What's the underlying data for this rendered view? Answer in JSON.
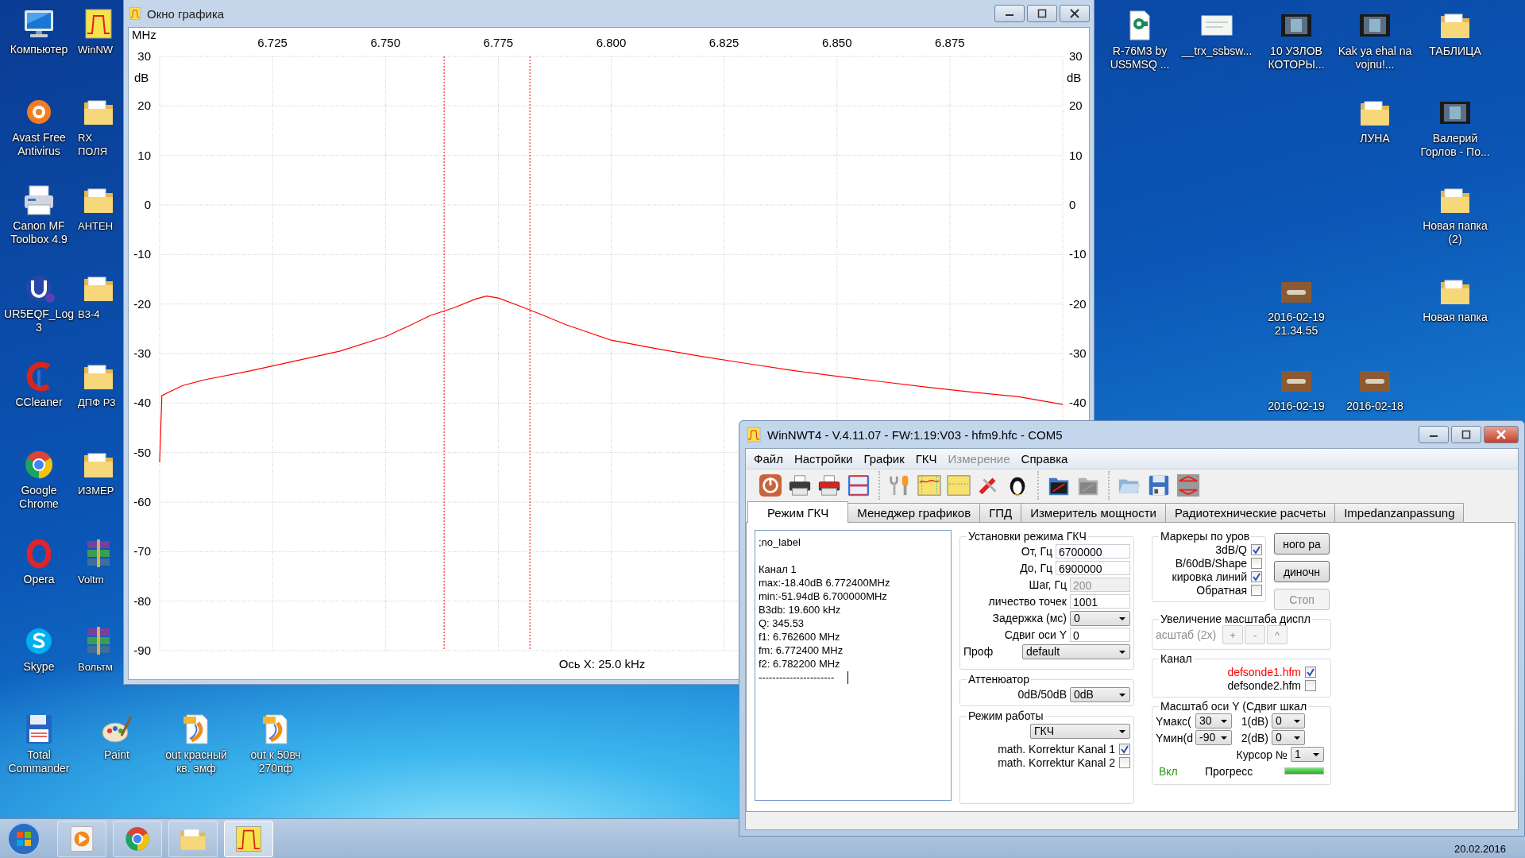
{
  "desktop": {
    "left_column": [
      {
        "label": "Компьютер",
        "kind": "computer"
      },
      {
        "label": "Avast Free Antivirus",
        "kind": "avast"
      },
      {
        "label": "Canon MF Toolbox 4.9",
        "kind": "printer"
      },
      {
        "label": "UR5EQF_Log 3",
        "kind": "log"
      },
      {
        "label": "CCleaner",
        "kind": "ccleaner"
      },
      {
        "label": "Google Chrome",
        "kind": "chrome"
      },
      {
        "label": "Opera",
        "kind": "opera"
      },
      {
        "label": "Skype",
        "kind": "skype"
      },
      {
        "label": "Total Commander",
        "kind": "floppy"
      }
    ],
    "second_column": [
      {
        "label": "WinNW",
        "kind": "chart-app"
      },
      {
        "label": "RX ПОЛЯ",
        "kind": "folder"
      },
      {
        "label": "АНТЕН",
        "kind": "folder"
      },
      {
        "label": "В3-4",
        "kind": "folder"
      },
      {
        "label": "ДПФ Р3",
        "kind": "folder"
      },
      {
        "label": "ИЗМЕР",
        "kind": "folder"
      },
      {
        "label": "Voltm",
        "kind": "archive"
      },
      {
        "label": "Вольтм",
        "kind": "archive"
      }
    ],
    "bottom_row": [
      {
        "label": "Paint",
        "kind": "paint"
      },
      {
        "label": "out красный кв. эмф",
        "kind": "pdf"
      },
      {
        "label": "out к 50вч 270пф",
        "kind": "pdf"
      }
    ],
    "right_area": [
      {
        "label": "R-76M3 by US5MSQ ...",
        "kind": "document"
      },
      {
        "label": "__trx_ssbsw...",
        "kind": "image"
      },
      {
        "label": "10 УЗЛОВ КОТОРЫ...",
        "kind": "video"
      },
      {
        "label": "Kak ya ehal na vojnu!...",
        "kind": "video"
      },
      {
        "label": "ТАБЛИЦА",
        "kind": "folder"
      },
      {
        "label": "ЛУНА",
        "kind": "folder"
      },
      {
        "label": "Валерий Горлов - По...",
        "kind": "video"
      },
      {
        "label": "Новая папка (2)",
        "kind": "folder"
      },
      {
        "label": "2016-02-19 21.34.55",
        "kind": "photo"
      },
      {
        "label": "Новая папка",
        "kind": "folder"
      },
      {
        "label": "2016-02-19",
        "kind": "photo"
      },
      {
        "label": "2016-02-18",
        "kind": "photo"
      }
    ]
  },
  "chart_window": {
    "title": "Окно графика",
    "x_unit": "MHz",
    "y_unit_left": "dB",
    "y_unit_right": "dB",
    "scale_label": "Ось X: 25.0 kHz",
    "chart_data": {
      "type": "line",
      "xlim": [
        6.7,
        6.9
      ],
      "ylim": [
        -90,
        30
      ],
      "x": [
        6.7,
        6.7005,
        6.705,
        6.71,
        6.72,
        6.73,
        6.74,
        6.75,
        6.755,
        6.76,
        6.765,
        6.77,
        6.7724,
        6.775,
        6.78,
        6.785,
        6.79,
        6.8,
        6.81,
        6.82,
        6.83,
        6.84,
        6.85,
        6.86,
        6.87,
        6.88,
        6.89,
        6.9
      ],
      "grid": true,
      "series": [
        {
          "color": "#ff0000",
          "values": [
            -52,
            -38.5,
            -36.5,
            -35.3,
            -33.5,
            -31.5,
            -29.5,
            -26.6,
            -24.5,
            -22.3,
            -20.8,
            -19.0,
            -18.4,
            -18.8,
            -20.5,
            -22.3,
            -24.2,
            -27.3,
            -29.0,
            -30.6,
            -32.0,
            -33.4,
            -34.6,
            -35.7,
            -36.8,
            -37.8,
            -38.7,
            -40.3
          ]
        }
      ],
      "xticks": [
        {
          "value": 6.725,
          "label": "6.725"
        },
        {
          "value": 6.75,
          "label": "6.750"
        },
        {
          "value": 6.775,
          "label": "6.775"
        },
        {
          "value": 6.8,
          "label": "6.800"
        },
        {
          "value": 6.825,
          "label": "6.825"
        },
        {
          "value": 6.85,
          "label": "6.850"
        },
        {
          "value": 6.875,
          "label": "6.875"
        }
      ],
      "yticks": [
        {
          "value": 30,
          "label": "30"
        },
        {
          "value": 20,
          "label": "20"
        },
        {
          "value": 10,
          "label": "10"
        },
        {
          "value": 0,
          "label": "0"
        },
        {
          "value": -10,
          "label": "-10"
        },
        {
          "value": -20,
          "label": "-20"
        },
        {
          "value": -30,
          "label": "-30"
        },
        {
          "value": -40,
          "label": "-40"
        },
        {
          "value": -50,
          "label": "-50"
        },
        {
          "value": -60,
          "label": "-60"
        },
        {
          "value": -70,
          "label": "-70"
        },
        {
          "value": -80,
          "label": "-80"
        },
        {
          "value": -90,
          "label": "-90"
        }
      ],
      "ref_lines": [
        {
          "axis": "x",
          "value": 6.763
        },
        {
          "axis": "x",
          "value": 6.782
        }
      ]
    }
  },
  "winnwt": {
    "title": "WinNWT4 - V.4.11.07 - FW:1.19:V03 - hfm9.hfc - COM5",
    "menu": [
      {
        "label": "Файл",
        "disabled": false
      },
      {
        "label": "Настройки",
        "disabled": false
      },
      {
        "label": "График",
        "disabled": false
      },
      {
        "label": "ГКЧ",
        "disabled": false
      },
      {
        "label": "Измерение",
        "disabled": true
      },
      {
        "label": "Справка",
        "disabled": false
      }
    ],
    "toolbar": [
      [
        {
          "kind": "power",
          "disabled": false
        },
        {
          "kind": "printer",
          "disabled": false
        },
        {
          "kind": "pdf-printer",
          "disabled": false
        },
        {
          "kind": "image-export",
          "disabled": false
        }
      ],
      [
        {
          "kind": "wrench",
          "disabled": false
        },
        {
          "kind": "wave-chart",
          "disabled": false
        },
        {
          "kind": "db-chart",
          "disabled": false
        },
        {
          "kind": "tools",
          "disabled": false
        },
        {
          "kind": "penguin",
          "disabled": false
        }
      ],
      [
        {
          "kind": "channel-folder",
          "disabled": false
        },
        {
          "kind": "channel-folder",
          "disabled": true
        }
      ],
      [
        {
          "kind": "folder-open",
          "disabled": false
        },
        {
          "kind": "save",
          "disabled": false
        },
        {
          "kind": "arrows",
          "disabled": false
        }
      ]
    ],
    "tabs": [
      {
        "label": "Режим ГКЧ",
        "selected": true
      },
      {
        "label": "Менеджер графиков",
        "selected": false
      },
      {
        "label": "ГПД",
        "selected": false
      },
      {
        "label": "Измеритель мощности",
        "selected": false
      },
      {
        "label": "Радиотехнические расчеты",
        "selected": false
      },
      {
        "label": "Impedanzanpassung",
        "selected": false
      }
    ],
    "info_blocks": [
      [
        ";no_label"
      ],
      [
        "Канал 1",
        "max:-18.40dB 6.772400MHz",
        "min:-51.94dB 6.700000MHz",
        "B3db: 19.600 kHz",
        "Q: 345.53",
        "f1: 6.762600 MHz",
        "fm: 6.772400 MHz",
        "f2: 6.782200 MHz",
        "----------------------"
      ]
    ],
    "settings": {
      "title": "Установки режима ГКЧ",
      "fields": [
        {
          "label": "От, Гц",
          "value": "6700000",
          "kind": "input",
          "disabled": false
        },
        {
          "label": "До, Гц",
          "value": "6900000",
          "kind": "input",
          "disabled": false
        },
        {
          "label": "Шаг, Гц",
          "value": "200",
          "kind": "input",
          "disabled": true
        },
        {
          "label": "личество точек",
          "value": "1001",
          "kind": "input",
          "disabled": false
        },
        {
          "label": "Задержка (мс)",
          "value": "0",
          "kind": "select",
          "disabled": false
        },
        {
          "label": "Сдвиг оси Y",
          "value": "0",
          "kind": "input",
          "disabled": false
        },
        {
          "label": "Проф",
          "value": "default",
          "kind": "wide-select",
          "disabled": false
        }
      ]
    },
    "attenuator": {
      "title": "Аттенюатор",
      "label": "0dB/50dB",
      "value": "0dB"
    },
    "mode": {
      "title": "Режим работы",
      "value": "ГКЧ",
      "checks": [
        {
          "label": "math. Korrektur Kanal 1",
          "checked": true
        },
        {
          "label": "math. Korrektur Kanal 2",
          "checked": false
        }
      ]
    },
    "markers": {
      "title": "Маркеры по уров",
      "checks": [
        {
          "label": "3dB/Q",
          "checked": true
        },
        {
          "label": "B/60dB/Shape",
          "checked": false
        },
        {
          "label": "кировка линий",
          "checked": true
        },
        {
          "label": "Обратная",
          "checked": false
        }
      ]
    },
    "side_buttons": [
      {
        "label": "ного ра",
        "disabled": false
      },
      {
        "label": "диночн",
        "disabled": false
      },
      {
        "label": "Стоп",
        "disabled": true
      }
    ],
    "zoom": {
      "title": "Увеличение масштаба диспл",
      "label": "асштаб (2x)",
      "disabled": true,
      "buttons": [
        "+",
        "-",
        "^"
      ]
    },
    "channel": {
      "title": "Канал",
      "items": [
        {
          "label": "defsonde1.hfm",
          "checked": true,
          "color": "#ff0000"
        },
        {
          "label": "defsonde2.hfm",
          "checked": false,
          "color": "#000000"
        }
      ]
    },
    "y_scale": {
      "title": "Масштаб оси Y (Сдвиг шкал",
      "rows": [
        {
          "label": "Yмакс(",
          "value": "30",
          "shift_label": "1(dB)",
          "shift_value": "0"
        },
        {
          "label": "Yмин(d",
          "value": "-90",
          "shift_label": "2(dB)",
          "shift_value": "0"
        }
      ],
      "cursor": {
        "label": "Курсор №",
        "value": "1"
      },
      "status": {
        "label": "Вкл",
        "on": true
      },
      "progress": {
        "label": "Прогресс",
        "level": 1
      }
    }
  },
  "taskbar": {
    "items": [
      {
        "kind": "media",
        "selected": false
      },
      {
        "kind": "chrome",
        "selected": false
      },
      {
        "kind": "explorer",
        "selected": false
      },
      {
        "kind": "chart",
        "selected": true
      }
    ],
    "date": "20.02.2016"
  }
}
